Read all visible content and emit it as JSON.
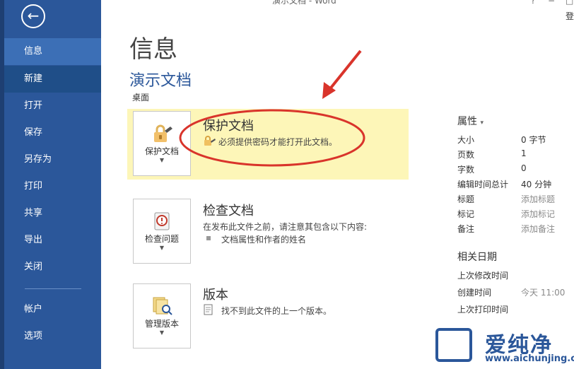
{
  "window": {
    "title": "演示文档 - Word",
    "help": "?",
    "minimize": "−",
    "restore": "□",
    "signin": "登"
  },
  "sidebar": {
    "items": [
      {
        "label": "信息"
      },
      {
        "label": "新建"
      },
      {
        "label": "打开"
      },
      {
        "label": "保存"
      },
      {
        "label": "另存为"
      },
      {
        "label": "打印"
      },
      {
        "label": "共享"
      },
      {
        "label": "导出"
      },
      {
        "label": "关闭"
      },
      {
        "label": "帐户"
      },
      {
        "label": "选项"
      }
    ]
  },
  "main": {
    "title": "信息",
    "doc_name": "演示文档",
    "doc_path": "桌面",
    "protect": {
      "tile_label": "保护文档",
      "title": "保护文档",
      "desc": "必须提供密码才能打开此文档。"
    },
    "inspect": {
      "tile_label": "检查问题",
      "title": "检查文档",
      "desc": "在发布此文件之前，请注意其包含以下内容:",
      "bullet": "文档属性和作者的姓名"
    },
    "versions": {
      "tile_label": "管理版本",
      "title": "版本",
      "desc": "找不到此文件的上一个版本。"
    }
  },
  "properties": {
    "header": "属性",
    "rows": [
      {
        "key": "大小",
        "value": "0 字节"
      },
      {
        "key": "页数",
        "value": "1"
      },
      {
        "key": "字数",
        "value": "0"
      },
      {
        "key": "编辑时间总计",
        "value": "40 分钟"
      },
      {
        "key": "标题",
        "value": "添加标题"
      },
      {
        "key": "标记",
        "value": "添加标记"
      },
      {
        "key": "备注",
        "value": "添加备注"
      }
    ]
  },
  "dates": {
    "header": "相关日期",
    "rows": [
      {
        "key": "上次修改时间",
        "value": ""
      },
      {
        "key": "创建时间",
        "value": "今天 11:00"
      },
      {
        "key": "上次打印时间",
        "value": ""
      }
    ]
  },
  "watermark": {
    "text": "爱纯净",
    "url": "www.aichunjing.com"
  },
  "colors": {
    "sidebar": "#2b579a",
    "highlight": "#fdf6b8",
    "annotation": "#d9342b"
  }
}
